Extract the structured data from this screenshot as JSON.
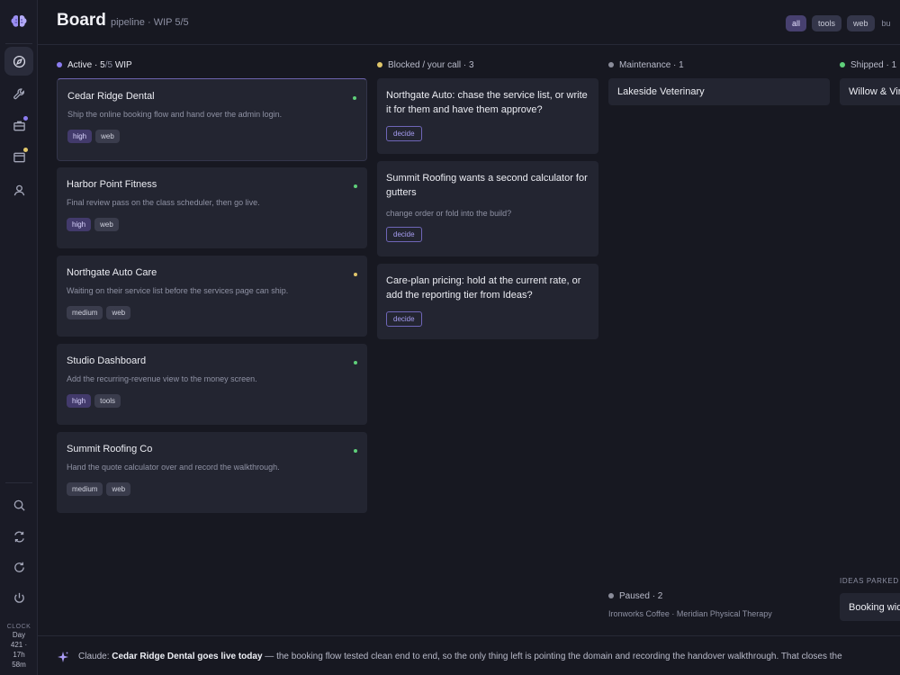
{
  "sidebar": {
    "logo_icon": "brain-icon",
    "nav": [
      {
        "icon": "compass-icon",
        "active": true
      },
      {
        "icon": "wrench-icon",
        "active": false
      },
      {
        "icon": "briefcase-icon",
        "badge_color": "#8b7cf0"
      },
      {
        "icon": "wallet-icon",
        "badge_color": "#e0c66a"
      },
      {
        "icon": "user-icon",
        "active": false
      }
    ],
    "bottom": [
      {
        "icon": "search-icon"
      },
      {
        "icon": "sync-icon"
      },
      {
        "icon": "refresh-icon"
      },
      {
        "icon": "power-icon"
      }
    ],
    "clock": {
      "label": "CLOCK",
      "line1": "Day",
      "line2": "421 ·",
      "line3": "17h",
      "line4": "58m"
    }
  },
  "header": {
    "title": "Board",
    "subtitle": "pipeline · WIP 5/5",
    "filters": [
      "all",
      "tools",
      "web"
    ],
    "filter_selected": "all",
    "trailing_label": "bu"
  },
  "colors": {
    "active": "#8b7cf0",
    "blocked": "#e0c66a",
    "maintenance": "#8a8c99",
    "shipped": "#5fd07a",
    "status_green": "#5fd07a",
    "status_yellow": "#e0c66a"
  },
  "columns": {
    "active": {
      "label": "Active ·",
      "count": "5",
      "total": "/5",
      "wip": "WIP",
      "cards": [
        {
          "name": "Cedar Ridge Dental",
          "desc": "Ship the online booking flow and hand over the admin login.",
          "tags": [
            "high",
            "web"
          ],
          "status": "green"
        },
        {
          "name": "Harbor Point Fitness",
          "desc": "Final review pass on the class scheduler, then go live.",
          "tags": [
            "high",
            "web"
          ],
          "status": "green"
        },
        {
          "name": "Northgate Auto Care",
          "desc": "Waiting on their service list before the services page can ship.",
          "tags": [
            "medium",
            "web"
          ],
          "status": "yellow"
        },
        {
          "name": "Studio Dashboard",
          "desc": "Add the recurring-revenue view to the money screen.",
          "tags": [
            "high",
            "tools"
          ],
          "status": "green"
        },
        {
          "name": "Summit Roofing Co",
          "desc": "Hand the quote calculator over and record the walkthrough.",
          "tags": [
            "medium",
            "web"
          ],
          "status": "green"
        }
      ]
    },
    "blocked": {
      "label": "Blocked / your call · 3",
      "cards": [
        {
          "text": "Northgate Auto: chase the service list, or write it for them and have them approve?",
          "sub": "",
          "action": "decide"
        },
        {
          "text": "Summit Roofing wants a second calculator for gutters",
          "sub": "change order or fold into the build?",
          "action": "decide"
        },
        {
          "text": "Care-plan pricing: hold at the current rate, or add the reporting tier from Ideas?",
          "sub": "",
          "action": "decide"
        }
      ]
    },
    "maintenance": {
      "label": "Maintenance · 1",
      "cards": [
        "Lakeside Veterinary"
      ]
    },
    "shipped": {
      "label": "Shipped · 1",
      "cards": [
        "Willow & Vin"
      ]
    },
    "paused": {
      "label": "Paused · 2",
      "items": "Ironworks Coffee · Meridian Physical Therapy"
    },
    "ideas": {
      "label": "IDEAS PARKED",
      "cards": [
        "Booking wid"
      ]
    }
  },
  "footer": {
    "icon": "sparkle-icon",
    "prefix": "Claude:",
    "headline": "Cedar Ridge Dental goes live today",
    "rest": "— the booking flow tested clean end to end, so the only thing left is pointing the domain and recording the handover walkthrough. That closes the"
  }
}
